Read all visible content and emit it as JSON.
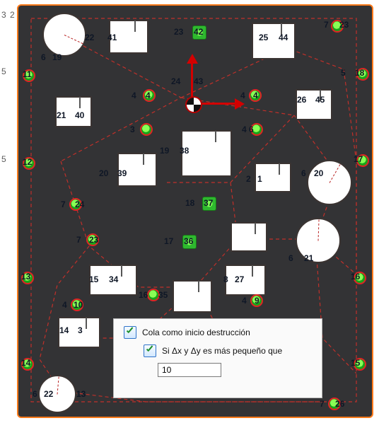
{
  "dialog": {
    "cb1": "Cola como inicio destrucción",
    "cb2": "Si Δx y Δy es más pequeño que",
    "value": "10"
  },
  "axis": {
    "a": "3",
    "b": "2",
    "c": "5",
    "d": "5"
  },
  "labels": {
    "n22": "22",
    "n41": "41",
    "n23": "23",
    "n42": "42",
    "n25": "25",
    "n44": "44",
    "n7": "7",
    "n7b": "23",
    "n6": "6",
    "n19": "19",
    "n5": "5",
    "n18": "18",
    "n11": "11",
    "n24": "24",
    "n43": "43",
    "n4a": "4",
    "n4b": "4",
    "n4c": "4",
    "n4d": "4",
    "n26": "26",
    "n45": "45",
    "n21": "21",
    "n40": "40",
    "n3": "3",
    "n46": "4 6",
    "n12": "12",
    "n19b": "19",
    "n38": "38",
    "n17": "17",
    "n20": "20",
    "n39": "39",
    "n2": "2",
    "n1": "1",
    "n6b": "6",
    "n20b": "20",
    "n7c": "7",
    "n24b": "24",
    "n18b": "18",
    "n37": "37",
    "n7d": "7",
    "n23b": "23",
    "n17b": "17",
    "n36": "36",
    "n13": "13",
    "n15": "15",
    "n34": "34",
    "n8": "8",
    "n27": "27",
    "n6c": "6",
    "n21b": "21",
    "n16b": "16",
    "n4e": "4",
    "n10": "10",
    "n16": "16",
    "n35": "35",
    "n4f": "4",
    "n9": "9",
    "n14r": "14",
    "n3r": "3",
    "n15b": "15",
    "n14": "14",
    "n6d": "6",
    "n22b": "22",
    "n13b": "13",
    "n7e": "7",
    "n26b": "26"
  }
}
